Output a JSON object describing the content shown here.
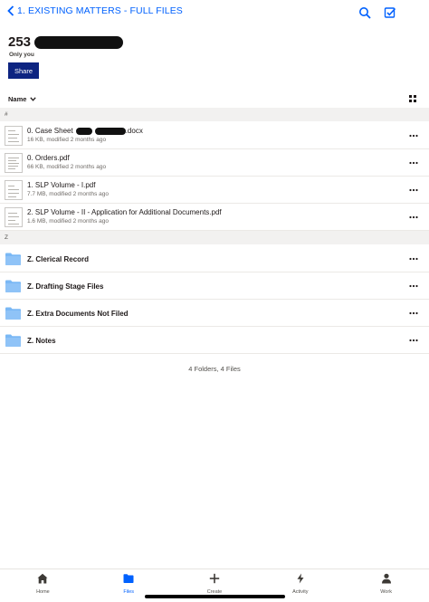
{
  "nav": {
    "back_label": "1. EXISTING MATTERS - FULL FILES",
    "search_icon": "search-icon",
    "select_icon": "select-checkbox-icon"
  },
  "header": {
    "title": "253",
    "subtitle": "Only you",
    "share_label": "Share"
  },
  "sort": {
    "label": "Name",
    "view_icon": "grid-view-icon"
  },
  "sections": {
    "files_header": "#",
    "folders_header": "Z"
  },
  "files": [
    {
      "name_prefix": "0. Case Sheet",
      "name_suffix": ".docx",
      "meta": "16 KB, modified 2 months ago"
    },
    {
      "name": "0. Orders.pdf",
      "meta": "66 KB, modified 2 months ago"
    },
    {
      "name": "1. SLP Volume - I.pdf",
      "meta": "7.7 MB, modified 2 months ago"
    },
    {
      "name": "2. SLP Volume - II - Application for Additional Documents.pdf",
      "meta": "1.6 MB, modified 2 months ago"
    }
  ],
  "folders": [
    {
      "name": "Z. Clerical Record"
    },
    {
      "name": "Z. Drafting Stage Files"
    },
    {
      "name": "Z. Extra Documents Not Filed"
    },
    {
      "name": "Z. Notes"
    }
  ],
  "summary": "4 Folders, 4 Files",
  "tabs": [
    {
      "label": "Home",
      "icon": "home-icon",
      "active": false
    },
    {
      "label": "Files",
      "icon": "folder-icon",
      "active": true
    },
    {
      "label": "Create",
      "icon": "plus-icon",
      "active": false
    },
    {
      "label": "Activity",
      "icon": "lightning-icon",
      "active": false
    },
    {
      "label": "Work",
      "icon": "person-icon",
      "active": false
    }
  ],
  "colors": {
    "accent": "#0061fe",
    "share_button": "#0d2481",
    "folder": "#7ab8f5"
  }
}
